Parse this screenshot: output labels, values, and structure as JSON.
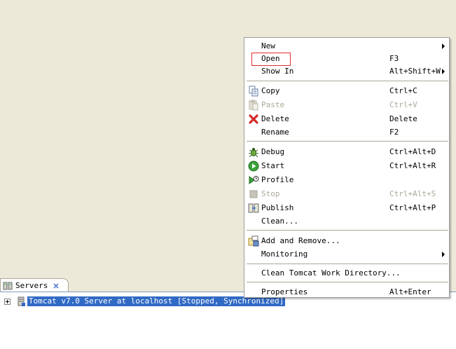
{
  "servers_view": {
    "tab_label": "Servers",
    "server_entry": "Tomcat v7.0 Server at localhost  [Stopped, Synchronized]"
  },
  "context_menu": {
    "items": [
      {
        "label": "New",
        "accel": "",
        "submenu": true,
        "enabled": true
      },
      {
        "label": "Open",
        "accel": "F3",
        "submenu": false,
        "enabled": true
      },
      {
        "label": "Show In",
        "accel": "Alt+Shift+W",
        "submenu": true,
        "enabled": true
      },
      {
        "label": "Copy",
        "accel": "Ctrl+C",
        "icon": "copy-icon",
        "enabled": true
      },
      {
        "label": "Paste",
        "accel": "Ctrl+V",
        "icon": "paste-icon",
        "enabled": false
      },
      {
        "label": "Delete",
        "accel": "Delete",
        "icon": "delete-icon",
        "enabled": true
      },
      {
        "label": "Rename",
        "accel": "F2",
        "enabled": true
      },
      {
        "label": "Debug",
        "accel": "Ctrl+Alt+D",
        "icon": "debug-icon",
        "enabled": true
      },
      {
        "label": "Start",
        "accel": "Ctrl+Alt+R",
        "icon": "start-icon",
        "enabled": true
      },
      {
        "label": "Profile",
        "accel": "",
        "icon": "profile-icon",
        "enabled": true
      },
      {
        "label": "Stop",
        "accel": "Ctrl+Alt+S",
        "icon": "stop-icon",
        "enabled": false
      },
      {
        "label": "Publish",
        "accel": "Ctrl+Alt+P",
        "icon": "publish-icon",
        "enabled": true
      },
      {
        "label": "Clean...",
        "accel": "",
        "enabled": true
      },
      {
        "label": "Add and Remove...",
        "accel": "",
        "icon": "add-remove-icon",
        "enabled": true
      },
      {
        "label": "Monitoring",
        "accel": "",
        "submenu": true,
        "enabled": true
      },
      {
        "label": "Clean Tomcat Work Directory...",
        "accel": "",
        "enabled": true
      },
      {
        "label": "Properties",
        "accel": "Alt+Enter",
        "enabled": true
      }
    ]
  },
  "colors": {
    "selection": "#316AC5",
    "highlight_box": "#E03030",
    "disabled_text": "#ACA899",
    "background": "#ECE9D8"
  }
}
